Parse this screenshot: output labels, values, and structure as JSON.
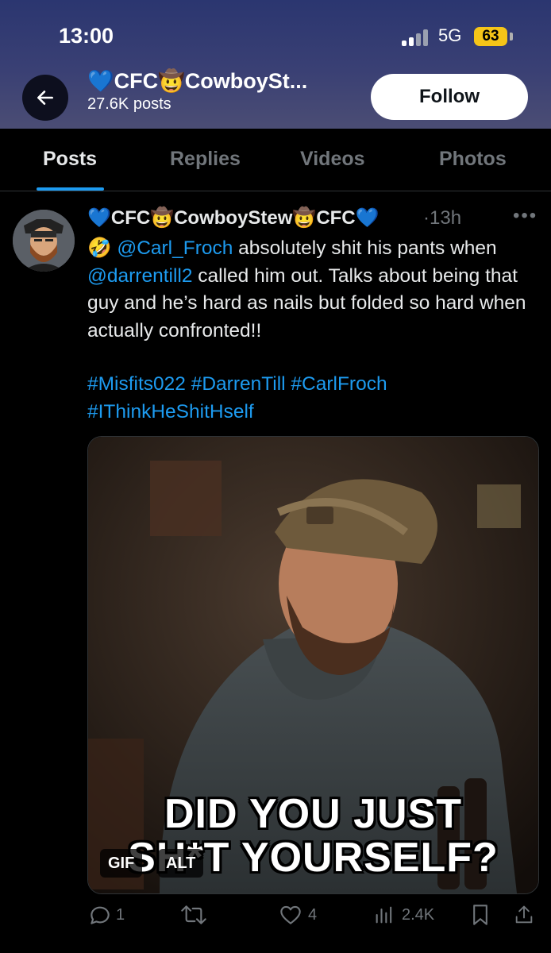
{
  "status_bar": {
    "time": "13:00",
    "network": "5G",
    "battery": "63"
  },
  "profile_header": {
    "title": "💙CFC🤠CowboySt...",
    "posts_count": "27.6K posts",
    "follow_label": "Follow"
  },
  "tabs": [
    {
      "label": "Posts"
    },
    {
      "label": "Replies"
    },
    {
      "label": "Videos"
    },
    {
      "label": "Photos"
    }
  ],
  "post": {
    "display_name": "💙CFC🤠CowboyStew🤠CFC💙",
    "time": "·13h",
    "text": {
      "emoji": "🤣",
      "mention1": "@Carl_Froch",
      "part1": " absolutely shit his pants when ",
      "mention2": "@darrentill2",
      "part2": " called him out. Talks about being that guy and he’s hard as nails but folded so hard when actually confronted!!"
    },
    "hashtags": {
      "line1": "#Misfits022 #DarrenTill #CarlFroch",
      "line2": "#IThinkHeShitHself"
    },
    "media": {
      "caption_line1": "DID YOU JUST",
      "caption_line2": "SH*T YOURSELF?",
      "gif_badge": "GIF",
      "alt_badge": "ALT"
    },
    "actions": {
      "replies": "1",
      "reposts": "",
      "likes": "4",
      "views": "2.4K"
    }
  },
  "colors": {
    "accent": "#1d9bf0",
    "muted": "#71767b",
    "background": "#000000"
  }
}
